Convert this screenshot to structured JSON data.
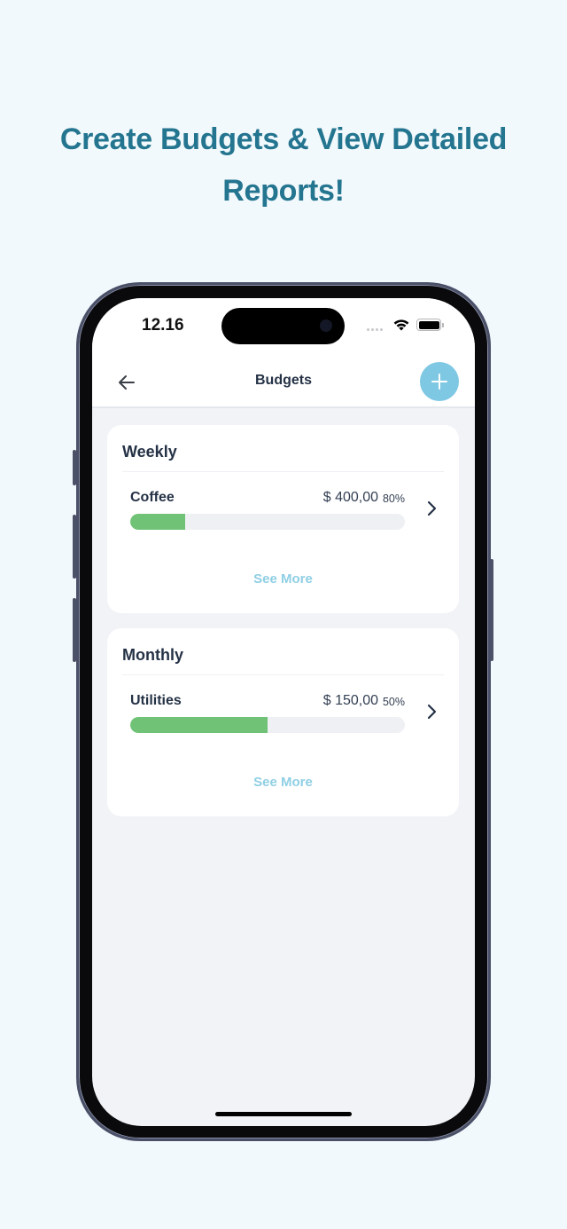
{
  "headline": {
    "line1": "Create Budgets & View Detailed",
    "line2": "Reports!"
  },
  "colors": {
    "headline": "#247590",
    "accent": "#7ec8e3",
    "progress_fill": "#6fc276",
    "progress_track": "#eef0f3",
    "text_dark": "#253246",
    "see_more": "#8fcfe4",
    "page_bg": "#f2f9fc"
  },
  "status_bar": {
    "time": "12.16",
    "icons": [
      "cellular-signal-icon",
      "wifi-icon",
      "battery-icon"
    ]
  },
  "nav": {
    "back_icon": "arrow-left-icon",
    "title": "Budgets",
    "add_icon": "plus-icon"
  },
  "sections": [
    {
      "title": "Weekly",
      "items": [
        {
          "name": "Coffee",
          "amount": "$ 400,00",
          "percent_label": "80%",
          "progress_fill_fraction": 0.2
        }
      ],
      "see_more_label": "See More"
    },
    {
      "title": "Monthly",
      "items": [
        {
          "name": "Utilities",
          "amount": "$ 150,00",
          "percent_label": "50%",
          "progress_fill_fraction": 0.5
        }
      ],
      "see_more_label": "See More"
    }
  ]
}
